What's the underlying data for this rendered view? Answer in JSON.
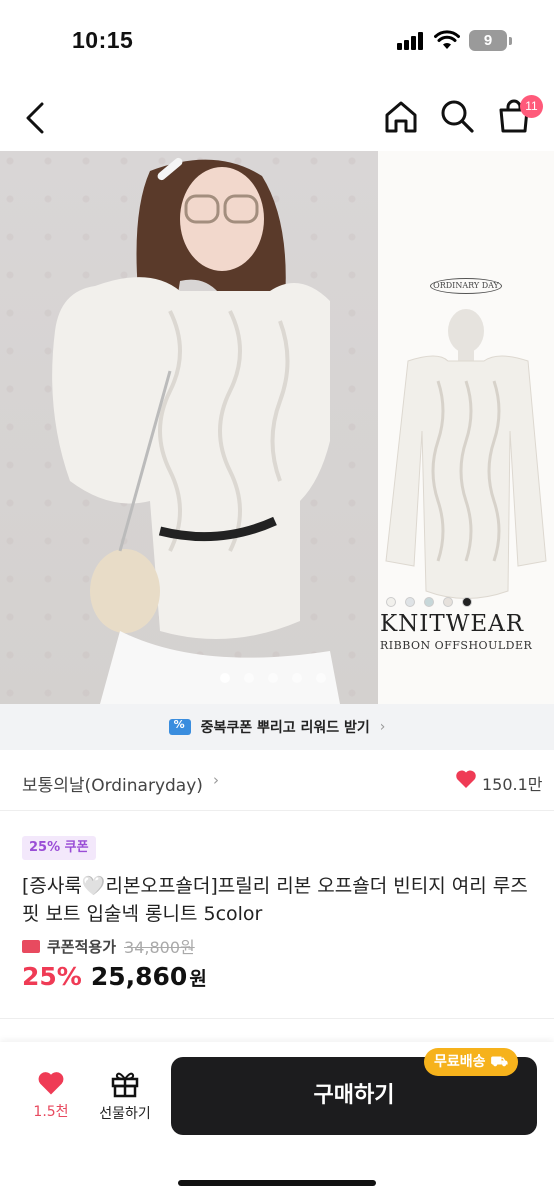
{
  "status": {
    "time": "10:15",
    "battery": "9"
  },
  "nav": {
    "cart_badge": "11"
  },
  "hero": {
    "brand_logo": "ORDINARY DAY",
    "knit_title": "KNITWEAR",
    "knit_sub": "RIBBON OFFSHOULDER",
    "pager_count": 5,
    "pager_active": 0,
    "swatches": [
      "#f1f0ec",
      "#dfe3e6",
      "#c7d7d9",
      "#e6e1dc",
      "#222222"
    ]
  },
  "coupon_banner": {
    "text": "중복쿠폰 뿌리고 리워드 받기",
    "chevron": "›"
  },
  "store": {
    "name": "보통의날(Ordinaryday)",
    "chevron": "›",
    "likes": "150.1만"
  },
  "product": {
    "coupon_tag": "25% 쿠폰",
    "title": "[증사룩🤍리본오프숄더]프릴리 리본 오프숄더 빈티지 여리 루즈핏 보트 입술넥 롱니트 5color",
    "coupon_label": "쿠폰적용가",
    "original_price": "34,800원",
    "discount": "25%",
    "final_price": "25,860",
    "currency": "원"
  },
  "bottom_bar": {
    "like_count": "1.5천",
    "gift_label": "선물하기",
    "buy_label": "구매하기",
    "free_shipping": "무료배송"
  },
  "colors": {
    "accent_red": "#ef3b55",
    "buy_button": "#1c1c1e",
    "shipping_badge": "#f6b21c"
  }
}
